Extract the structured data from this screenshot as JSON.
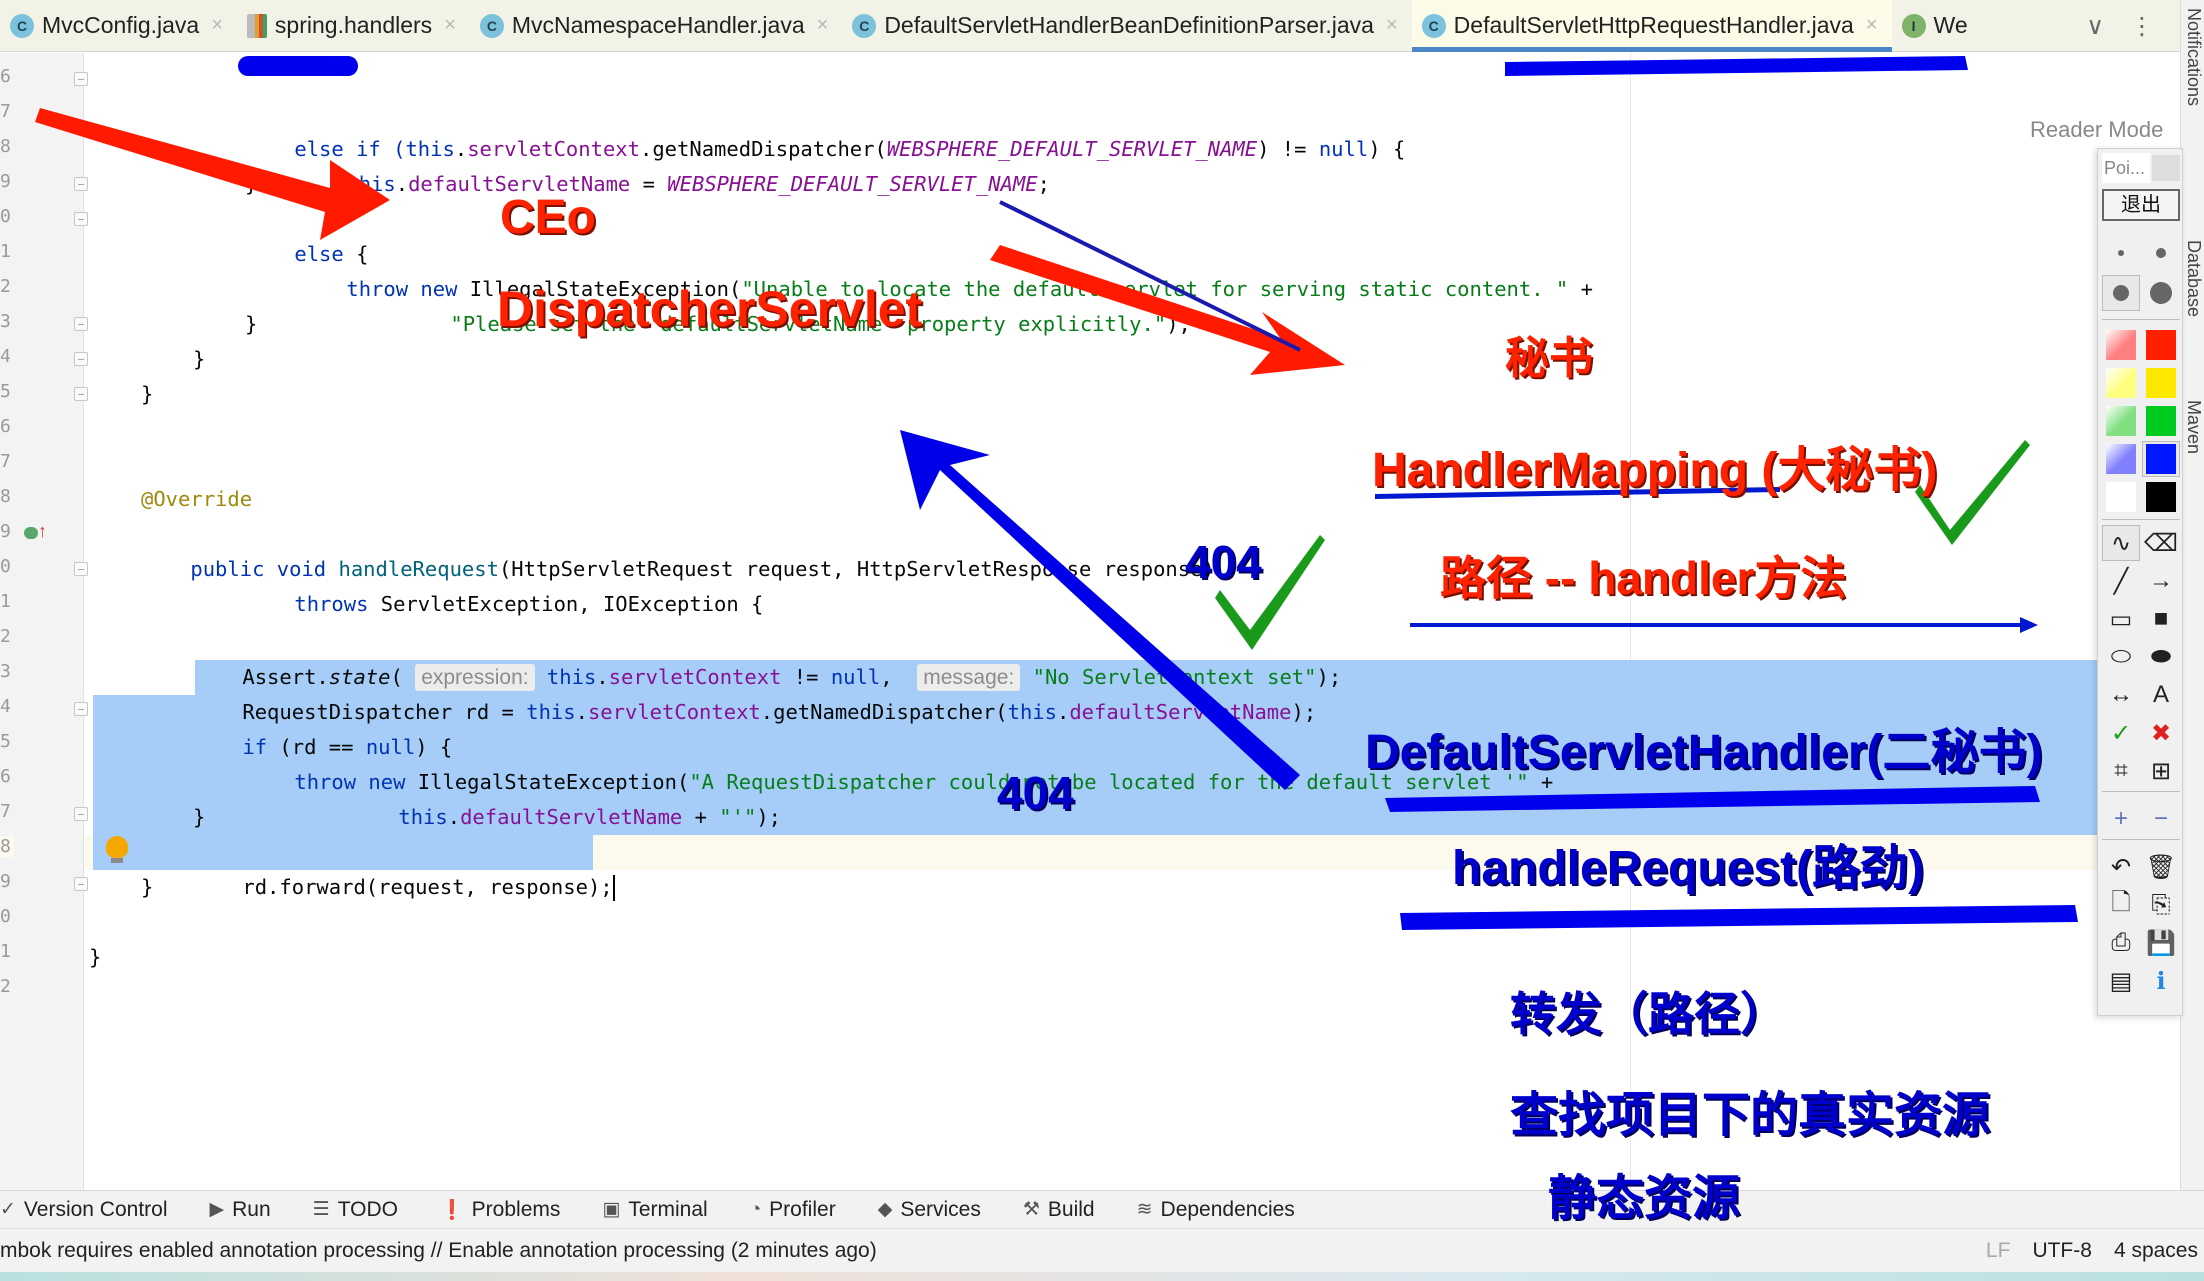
{
  "tabs": [
    {
      "label": "MvcConfig.java",
      "icon": "class-icon",
      "active": false
    },
    {
      "label": "spring.handlers",
      "icon": "file-icon",
      "active": false
    },
    {
      "label": "MvcNamespaceHandler.java",
      "icon": "class-icon",
      "active": false
    },
    {
      "label": "DefaultServletHandlerBeanDefinitionParser.java",
      "icon": "class-icon",
      "active": false
    },
    {
      "label": "DefaultServletHttpRequestHandler.java",
      "icon": "class-icon",
      "active": true
    },
    {
      "label": "We",
      "icon": "interface-icon",
      "active": false
    }
  ],
  "tab_icon_letters": {
    "class": "C",
    "interface": "I"
  },
  "tab_close_glyph": "×",
  "tab_tools": {
    "dropdown_glyph": "∨",
    "more_glyph": "⋮"
  },
  "reader_mode": {
    "label": "Reader Mode",
    "check_glyph": "✓"
  },
  "right_strip": [
    "Notifications",
    "Database",
    "Maven"
  ],
  "gutter": {
    "line_numbers": [
      "6",
      "7",
      "8",
      "9",
      "0",
      "1",
      "2",
      "3",
      "4",
      "5",
      "6",
      "7",
      "8",
      "9",
      "0",
      "1",
      "2",
      "3",
      "4",
      "5",
      "6",
      "7",
      "8",
      "9",
      "0",
      "1",
      "2"
    ]
  },
  "code": {
    "l7": {
      "a": "else if (",
      "b": "this",
      "c": ".",
      "d": "servletContext",
      "e": ".getNamedDispatcher(",
      "f": "WEBSPHERE_DEFAULT_SERVLET_NAME",
      "g": ") != ",
      "h": "null",
      "i": ") {"
    },
    "l8": {
      "a": "this",
      "b": ".",
      "c": "defaultServletName",
      "d": " = ",
      "e": "WEBSPHERE_DEFAULT_SERVLET_NAME",
      "f": ";"
    },
    "l9": "}",
    "l10": {
      "a": "else",
      "b": " {"
    },
    "l11": {
      "a": "throw new ",
      "b": "IllegalStateException(",
      "c": "\"Unable to locate the default servlet for serving static content. \"",
      "d": " +"
    },
    "l12": {
      "a": "\"Please set the 'defaultServletName' property explicitly.\"",
      "b": ");"
    },
    "l13": "}",
    "l14": "}",
    "l15": "}",
    "l18": "@Override",
    "l19": {
      "a": "public void ",
      "b": "handleRequest",
      "c": "(HttpServletRequest request, HttpServletResponse response)"
    },
    "l20": {
      "a": "throws ",
      "b": "ServletException, IOException {"
    },
    "l22": {
      "a": "Assert.",
      "b": "state",
      "c": "( ",
      "hint1": "expression:",
      "d": " this",
      "e": ".",
      "f": "servletContext",
      "g": " != ",
      "h": "null",
      "i": ",  ",
      "hint2": "message:",
      "j": " \"No ServletContext set\"",
      "k": ");"
    },
    "l23": {
      "a": "RequestDispatcher rd = ",
      "b": "this",
      "c": ".",
      "d": "servletContext",
      "e": ".getNamedDispatcher(",
      "f": "this",
      "g": ".",
      "h": "defaultServletName",
      "i": ");"
    },
    "l24": {
      "a": "if",
      "b": " (rd == ",
      "c": "null",
      "d": ") {"
    },
    "l25": {
      "a": "throw new ",
      "b": "IllegalStateException(",
      "c": "\"A RequestDispatcher could not be located for the default servlet '\"",
      "d": " +"
    },
    "l26": {
      "a": "this",
      "b": ".",
      "c": "defaultServletName",
      "d": " + ",
      "e": "\"'\"",
      "f": ");"
    },
    "l27": "}",
    "l28": "rd.forward(request, response);",
    "l29": "}",
    "l31": "}"
  },
  "annotations": {
    "ceo": "CEo",
    "dispatcher_servlet": "DispatcherServlet",
    "secretary": "秘书",
    "handler_mapping": "HandlerMapping (大秘书)",
    "path_handler": "路径 --  handler方法",
    "status_404_a": "404",
    "status_404_b": "404",
    "default_servlet_handler": "DefaultServletHandler(二秘书)",
    "handle_request": "handleRequest(路劲)",
    "forward_path": "转发（路径）",
    "find_resources": "查找项目下的真实资源",
    "static_resources": "静态资源",
    "check_glyph": "✓",
    "colors": {
      "red": "#ff2200",
      "blue": "#0000e0",
      "green": "#1a9a1a"
    }
  },
  "draw_toolbar": {
    "title": "Poi...",
    "exit_label": "退出",
    "pen_sizes": [
      "small",
      "medium",
      "large",
      "xlarge"
    ],
    "colors": [
      "#ff8080",
      "#ff2000",
      "#ffff80",
      "#ffe800",
      "#80e080",
      "#00cc20",
      "#8080ff",
      "#0018ff",
      "#ffffff",
      "#000000"
    ],
    "tools": [
      {
        "name": "freehand",
        "glyph": "∿"
      },
      {
        "name": "eraser",
        "glyph": "⌫"
      },
      {
        "name": "line",
        "glyph": "╱"
      },
      {
        "name": "arrow",
        "glyph": "→"
      },
      {
        "name": "rectangle",
        "glyph": "▭"
      },
      {
        "name": "filled-rectangle",
        "glyph": "■"
      },
      {
        "name": "ellipse",
        "glyph": "⬭"
      },
      {
        "name": "filled-ellipse",
        "glyph": "⬬"
      },
      {
        "name": "double-arrow",
        "glyph": "↔"
      },
      {
        "name": "text",
        "glyph": "A"
      },
      {
        "name": "check",
        "glyph": "✓"
      },
      {
        "name": "cross",
        "glyph": "✖"
      },
      {
        "name": "crop",
        "glyph": "⌗"
      },
      {
        "name": "zoom",
        "glyph": "⊞"
      },
      {
        "name": "zoom-in",
        "glyph": "+"
      },
      {
        "name": "zoom-out",
        "glyph": "−"
      },
      {
        "name": "undo",
        "glyph": "↶"
      },
      {
        "name": "delete",
        "glyph": "🗑"
      },
      {
        "name": "new",
        "glyph": "🗋"
      },
      {
        "name": "copy",
        "glyph": "⎘"
      },
      {
        "name": "print",
        "glyph": "⎙"
      },
      {
        "name": "save",
        "glyph": "💾"
      },
      {
        "name": "screen",
        "glyph": "▤"
      },
      {
        "name": "info",
        "glyph": "ℹ"
      }
    ]
  },
  "bottom_tools": [
    {
      "label": "Version Control",
      "icon": "✓"
    },
    {
      "label": "Run",
      "icon": "▶"
    },
    {
      "label": "TODO",
      "icon": "☰"
    },
    {
      "label": "Problems",
      "icon": "❗"
    },
    {
      "label": "Terminal",
      "icon": "▣"
    },
    {
      "label": "Profiler",
      "icon": "◔"
    },
    {
      "label": "Services",
      "icon": "◆"
    },
    {
      "label": "Build",
      "icon": "⚒"
    },
    {
      "label": "Dependencies",
      "icon": "≋"
    }
  ],
  "status": {
    "message": "mbok requires enabled annotation processing // Enable annotation processing (2 minutes ago)",
    "line_ending": "LF",
    "encoding": "UTF-8",
    "indent": "4 spaces"
  }
}
